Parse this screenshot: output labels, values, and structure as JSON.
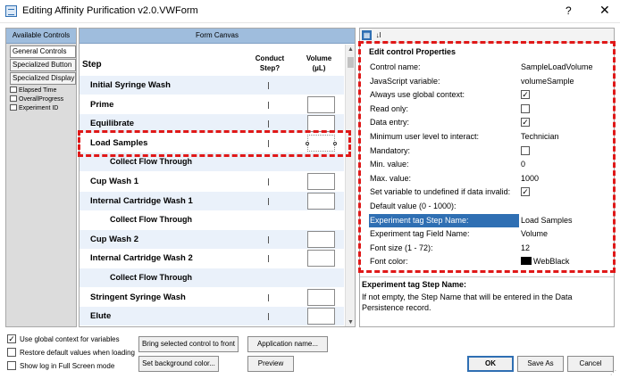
{
  "window": {
    "title": "Editing Affinity Purification v2.0.VWForm",
    "help_label": "?",
    "close_label": "✕"
  },
  "available_controls": {
    "header": "Available Controls",
    "buttons": [
      "General Controls",
      "Specialized Button",
      "Specialized Display"
    ],
    "items": [
      "Elapsed Time",
      "OverallProgress",
      "Experiment ID"
    ]
  },
  "form_canvas": {
    "header": "Form Canvas",
    "col_step": "Step",
    "col_conduct": "Conduct Step?",
    "col_volume": "Volume (µL)",
    "rows": [
      {
        "label": "Initial Syringe Wash",
        "sub": false,
        "volume_box": false
      },
      {
        "label": "Prime",
        "sub": false,
        "volume_box": true
      },
      {
        "label": "Equilibrate",
        "sub": false,
        "volume_box": true
      },
      {
        "label": "Load Samples",
        "sub": false,
        "volume_box": true
      },
      {
        "label": "Collect Flow Through",
        "sub": true,
        "volume_box": false
      },
      {
        "label": "Cup Wash 1",
        "sub": false,
        "volume_box": true
      },
      {
        "label": "Internal Cartridge Wash 1",
        "sub": false,
        "volume_box": true
      },
      {
        "label": "Collect Flow Through",
        "sub": true,
        "volume_box": false
      },
      {
        "label": "Cup Wash 2",
        "sub": false,
        "volume_box": true
      },
      {
        "label": "Internal Cartridge Wash 2",
        "sub": false,
        "volume_box": true
      },
      {
        "label": "Collect Flow Through",
        "sub": true,
        "volume_box": false
      },
      {
        "label": "Stringent Syringe Wash",
        "sub": false,
        "volume_box": true
      },
      {
        "label": "Elute",
        "sub": false,
        "volume_box": true
      }
    ]
  },
  "properties": {
    "toolbar": {
      "categorized_icon": "▦",
      "sort_icon": "↓l"
    },
    "section": "Edit control Properties",
    "rows": [
      {
        "name": "Control name:",
        "value": "SampleLoadVolume",
        "type": "text"
      },
      {
        "name": "JavaScript variable:",
        "value": "volumeSample",
        "type": "text"
      },
      {
        "name": "Always use global context:",
        "value": "✓",
        "type": "check"
      },
      {
        "name": "Read only:",
        "value": "",
        "type": "check"
      },
      {
        "name": "Data entry:",
        "value": "✓",
        "type": "check"
      },
      {
        "name": "Minimum user level to interact:",
        "value": "Technician",
        "type": "text"
      },
      {
        "name": "Mandatory:",
        "value": "",
        "type": "check"
      },
      {
        "name": "Min. value:",
        "value": "0",
        "type": "text"
      },
      {
        "name": "Max. value:",
        "value": "1000",
        "type": "text"
      },
      {
        "name": "Set variable to undefined if data invalid:",
        "value": "✓",
        "type": "check"
      },
      {
        "name": "Default value (0 - 1000):",
        "value": "",
        "type": "text"
      },
      {
        "name": "Experiment tag Step Name:",
        "value": "Load Samples",
        "type": "text",
        "selected": true
      },
      {
        "name": "Experiment tag Field Name:",
        "value": "Volume",
        "type": "text"
      },
      {
        "name": "Font size (1 - 72):",
        "value": "12",
        "type": "text"
      },
      {
        "name": "Font color:",
        "value": "WebBlack",
        "type": "color"
      }
    ],
    "description_title": "Experiment tag Step Name:",
    "description_text": "If not empty, the Step Name that will be entered in the Data Persistence record."
  },
  "bottom": {
    "checkboxes": [
      {
        "label": "Use global context for variables",
        "checked": "✓"
      },
      {
        "label": "Restore default values when loading",
        "checked": ""
      },
      {
        "label": "Show log in Full Screen mode",
        "checked": ""
      }
    ],
    "bring_front_label": "Bring selected control to front",
    "set_background_label": "Set background color...",
    "app_name_label": "Application name...",
    "preview_label": "Preview",
    "ok_label": "OK",
    "save_as_label": "Save As",
    "cancel_label": "Cancel"
  },
  "colors": {
    "panel_header": "#9fbddd",
    "selection_blue": "#2f6fb3",
    "highlight_red": "#e01818",
    "alt_row": "#eaf1fa"
  }
}
